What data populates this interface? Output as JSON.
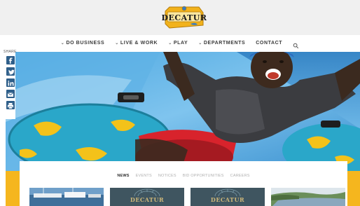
{
  "brand": {
    "logo_text": "DECATUR"
  },
  "nav": {
    "items": [
      {
        "label": "DO BUSINESS",
        "has_dropdown": true
      },
      {
        "label": "LIVE & WORK",
        "has_dropdown": true
      },
      {
        "label": "PLAY",
        "has_dropdown": true
      },
      {
        "label": "DEPARTMENTS",
        "has_dropdown": true
      },
      {
        "label": "CONTACT",
        "has_dropdown": false
      }
    ],
    "search_icon": "search-icon"
  },
  "share": {
    "label": "SHARE",
    "icons": [
      "facebook-icon",
      "twitter-icon",
      "linkedin-icon",
      "email-icon",
      "print-icon"
    ]
  },
  "hero": {
    "slide_count": 8,
    "active_slide": 0
  },
  "news": {
    "tabs": [
      {
        "label": "NEWS",
        "active": true
      },
      {
        "label": "EVENTS",
        "active": false
      },
      {
        "label": "NOTICES",
        "active": false
      },
      {
        "label": "BID OPPORTUNITIES",
        "active": false
      },
      {
        "label": "CAREERS",
        "active": false
      }
    ],
    "cards": [
      {
        "kind": "photo-marina"
      },
      {
        "kind": "logo",
        "word": "DECATUR"
      },
      {
        "kind": "logo",
        "word": "DECATUR"
      },
      {
        "kind": "photo-river"
      }
    ]
  },
  "colors": {
    "accent_yellow": "#f5b61e",
    "share_blue": "#2f5f8a",
    "card_dark": "#3f5560"
  }
}
